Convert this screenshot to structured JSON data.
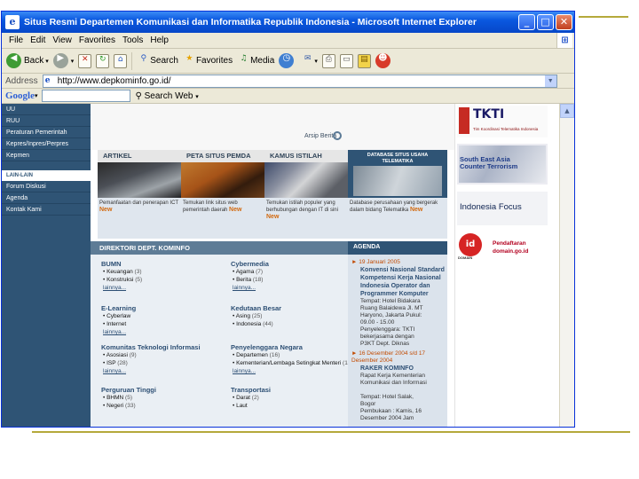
{
  "window": {
    "title": "Situs Resmi Departemen Komunikasi dan Informatika Republik Indonesia - Microsoft Internet Explorer",
    "minimize": "_",
    "maximize": "□",
    "close": "✕"
  },
  "menu": [
    "File",
    "Edit",
    "View",
    "Favorites",
    "Tools",
    "Help"
  ],
  "toolbar": {
    "back": "Back",
    "search": "Search",
    "favorites": "Favorites",
    "media": "Media"
  },
  "address": {
    "label": "Address",
    "url": "http://www.depkominfo.go.id/"
  },
  "google": {
    "logo": "Google",
    "search_web": "Search Web"
  },
  "leftnav": {
    "items": [
      "UU",
      "RUU",
      "Peraturan Pemerintah",
      "Kepres/Inpres/Perpres",
      "Kepmen"
    ],
    "section": "LAIN-LAIN",
    "items2": [
      "Forum Diskusi",
      "Agenda",
      "Kontak Kami"
    ]
  },
  "search": {
    "label": "Arsip Berita"
  },
  "tabs": [
    "ARTIKEL",
    "PETA SITUS PEMDA",
    "KAMUS ISTILAH"
  ],
  "db_box": {
    "title": "DATABASE SITUS USAHA TELEMATIKA"
  },
  "captions": [
    {
      "text": "Pemanfaatan dan penerapan ICT",
      "new": "New"
    },
    {
      "text": "Temukan link situs web pemerintah daerah",
      "new": "New"
    },
    {
      "text": "Temukan istilah populer yang berhubungan dengan IT di sini",
      "new": "New"
    },
    {
      "text": "Database perusahaan yang bergerak dalam bidang Telematika",
      "new": "New"
    }
  ],
  "directory": {
    "title": "DIREKTORI DEPT. KOMINFO",
    "left": [
      {
        "cat": "BUMN",
        "lines": [
          {
            "label": "• Keuangan",
            "count": "(3)"
          },
          {
            "label": "• Konstruksi",
            "count": "(5)"
          }
        ],
        "more": "lainnya..."
      },
      {
        "cat": "E-Learning",
        "lines": [
          {
            "label": "• Cyberlaw",
            "count": ""
          },
          {
            "label": "• Internet",
            "count": ""
          }
        ],
        "more": "lainnya..."
      },
      {
        "cat": "Komunitas Teknologi Informasi",
        "lines": [
          {
            "label": "• Asosiasi",
            "count": "(9)"
          },
          {
            "label": "• ISP",
            "count": "(28)"
          }
        ],
        "more": "lainnya..."
      },
      {
        "cat": "Perguruan Tinggi",
        "lines": [
          {
            "label": "• BHMN",
            "count": "(5)"
          },
          {
            "label": "• Negeri",
            "count": "(33)"
          }
        ],
        "more": ""
      }
    ],
    "right": [
      {
        "cat": "Cybermedia",
        "lines": [
          {
            "label": "• Agama",
            "count": "(7)"
          },
          {
            "label": "• Berita",
            "count": "(18)"
          }
        ],
        "more": "lainnya..."
      },
      {
        "cat": "Kedutaan Besar",
        "lines": [
          {
            "label": "• Asing",
            "count": "(25)"
          },
          {
            "label": "• Indonesia",
            "count": "(44)"
          }
        ],
        "more": ""
      },
      {
        "cat": "Penyelenggara Negara",
        "lines": [
          {
            "label": "• Departemen",
            "count": "(16)"
          },
          {
            "label": "• Kementerian/Lembaga Setingkat Menteri",
            "count": "(16)"
          }
        ],
        "more": "lainnya..."
      },
      {
        "cat": "Transportasi",
        "lines": [
          {
            "label": "• Darat",
            "count": "(2)"
          },
          {
            "label": "• Laut",
            "count": ""
          }
        ],
        "more": ""
      }
    ]
  },
  "agenda": {
    "title": "AGENDA",
    "items": [
      {
        "date": "19 Januari 2005",
        "title": "Konvensi Nasional Standard Kompetensi Kerja Nasional Indonesia Operator dan Programmer Komputer",
        "body": [
          "Tempat: Hotel Bidakara",
          "Ruang Balaidewa Jl. MT",
          "Haryono, Jakarta Pukul:",
          "09.00 - 15.00",
          "Penyelenggara: TKTI",
          "bekerjasama dengan",
          "P3KT Dept. Diknas"
        ]
      },
      {
        "date": "16 Desember 2004 s/d 17 Desember 2004",
        "title": "RAKER KOMINFO",
        "body": [
          "Rapat Kerja Kementerian",
          "Komunikasi dan Informasi",
          "",
          "Tempat: Hotel Salak,",
          "Bogor",
          "Pembukaan : Kamis, 16",
          "Desember 2004 Jam"
        ]
      }
    ]
  },
  "banners": {
    "tkti": {
      "big": "TKTI",
      "small": "Tim Koordinasi Telematika Indonesia"
    },
    "seact": {
      "line1": "South East Asia",
      "line2": "Counter Terrorism"
    },
    "ifocus": "Indonesia Focus",
    "domain": {
      "logo": "id",
      "tagline": "DOMAIN",
      "line1": "Pendaftaran",
      "line2": "domain.go.id"
    }
  }
}
